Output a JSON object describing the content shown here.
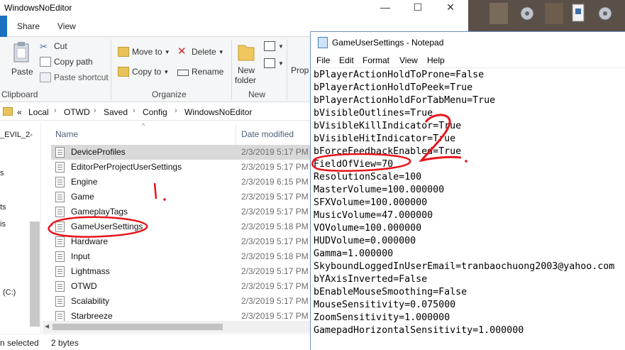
{
  "explorer": {
    "title": "WindowsNoEditor",
    "controls": {
      "minimize": "—",
      "maximize": "☐",
      "close": "✕"
    },
    "ribbon_tabs": [
      "Share",
      "View"
    ],
    "ribbon": {
      "paste": "Paste",
      "cut": "Cut",
      "copy_path": "Copy path",
      "paste_shortcut": "Paste shortcut",
      "clipboard_group": "Clipboard",
      "move_to": "Move to",
      "copy_to": "Copy to",
      "delete": "Delete",
      "rename": "Rename",
      "organize_group": "Organize",
      "new_folder_1": "New",
      "new_folder_2": "folder",
      "new_group": "New",
      "properties": "Prop"
    },
    "breadcrumb": [
      "«",
      "Local",
      "OTWD",
      "Saved",
      "Config",
      "WindowsNoEditor"
    ],
    "nav_items": [
      "_EVIL_2-",
      "s",
      "ts",
      "is",
      "(C:)"
    ],
    "columns": {
      "name": "Name",
      "date": "Date modified"
    },
    "files": [
      {
        "name": "DeviceProfiles",
        "date": "2/3/2019 5:17 PM"
      },
      {
        "name": "EditorPerProjectUserSettings",
        "date": "2/3/2019 5:17 PM"
      },
      {
        "name": "Engine",
        "date": "2/3/2019 6:15 PM"
      },
      {
        "name": "Game",
        "date": "2/3/2019 5:17 PM"
      },
      {
        "name": "GameplayTags",
        "date": "2/3/2019 5:17 PM"
      },
      {
        "name": "GameUserSettings",
        "date": "2/3/2019 5:18 PM"
      },
      {
        "name": "Hardware",
        "date": "2/3/2019 5:17 PM"
      },
      {
        "name": "Input",
        "date": "2/3/2019 5:18 PM"
      },
      {
        "name": "Lightmass",
        "date": "2/3/2019 5:17 PM"
      },
      {
        "name": "OTWD",
        "date": "2/3/2019 5:17 PM"
      },
      {
        "name": "Scalability",
        "date": "2/3/2019 5:17 PM"
      },
      {
        "name": "Starbreeze",
        "date": "2/3/2019 5:17 PM"
      }
    ],
    "status": {
      "left": "n selected",
      "size": "2 bytes"
    }
  },
  "notepad": {
    "title": "GameUserSettings - Notepad",
    "menu": [
      "File",
      "Edit",
      "Format",
      "View",
      "Help"
    ],
    "lines": [
      "bPlayerActionHoldToProne=False",
      "bPlayerActionHoldToPeek=True",
      "bPlayerActionHoldForTabMenu=True",
      "bVisibleOutlines=True",
      "bVisibleKillIndicator=True",
      "bVisibleHitIndicator=True",
      "bForceFeedbackEnabled=True",
      "FieldOfView=70",
      "ResolutionScale=100",
      "MasterVolume=100.000000",
      "SFXVolume=100.000000",
      "MusicVolume=47.000000",
      "VOVolume=100.000000",
      "HUDVolume=0.000000",
      "Gamma=1.000000",
      "SkyboundLoggedInUserEmail=tranbaochuong2003@yahoo.com",
      "bYAxisInverted=False",
      "bEnableMouseSmoothing=False",
      "MouseSensitivity=0.075000",
      "ZoomSensitivity=1.000000",
      "GamepadHorizontalSensitivity=1.000000"
    ]
  },
  "annotations": {
    "step1": "1.",
    "step2": "2."
  },
  "colors": {
    "annotation": "#e8141c",
    "selection": "#d9d9d9",
    "accent": "#1a6fbf"
  }
}
